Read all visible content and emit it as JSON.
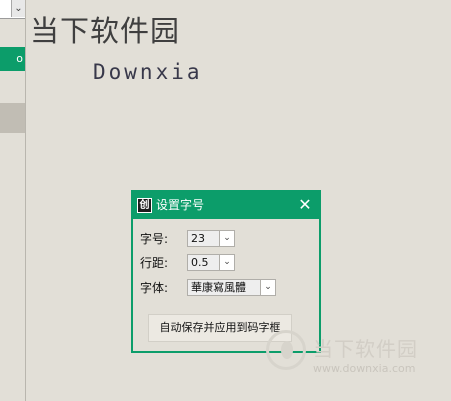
{
  "left_panel": {
    "green_item_text": "o"
  },
  "canvas": {
    "preview_chinese": "当下软件园",
    "preview_english": "Downxia"
  },
  "dialog": {
    "title": "设置字号",
    "close_glyph": "✕",
    "app_icon_glyph": "创",
    "font_size_label": "字号:",
    "font_size_value": "23",
    "line_spacing_label": "行距:",
    "line_spacing_value": "0.5",
    "font_label": "字体:",
    "font_value": "華康寫風體",
    "save_button_label": "自动保存并应用到码字框",
    "dropdown_glyph": "⌄"
  },
  "watermark": {
    "title": "当下软件园",
    "url": "www.downxia.com"
  },
  "colors": {
    "accent": "#0c9d6a",
    "background": "#e2dfd7"
  }
}
